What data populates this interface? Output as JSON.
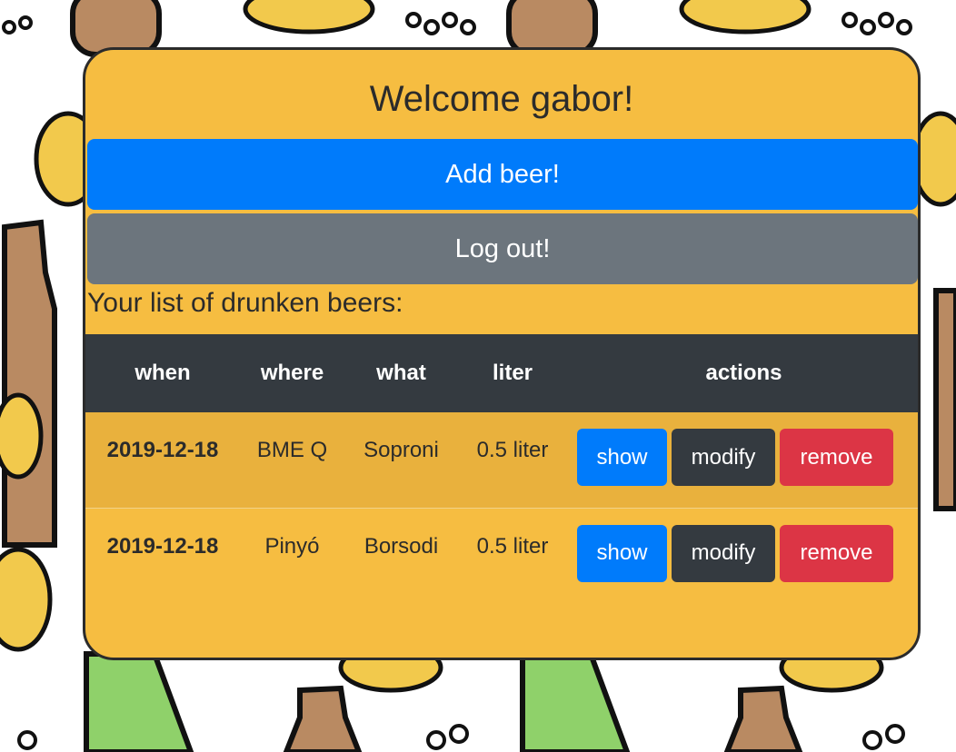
{
  "header": {
    "welcome": "Welcome gabor!"
  },
  "buttons": {
    "add_beer": "Add beer!",
    "log_out": "Log out!"
  },
  "list": {
    "title": "Your list of drunken beers:",
    "columns": [
      "when",
      "where",
      "what",
      "liter",
      "actions"
    ],
    "rows": [
      {
        "when": "2019-12-18",
        "where": "BME Q",
        "what": "Soproni",
        "liter": "0.5 liter",
        "show": "show",
        "modify": "modify",
        "remove": "remove"
      },
      {
        "when": "2019-12-18",
        "where": "Pinyó",
        "what": "Borsodi",
        "liter": "0.5 liter",
        "show": "show",
        "modify": "modify",
        "remove": "remove"
      }
    ]
  },
  "colors": {
    "panel": "#f6bd41",
    "primary": "#007bfb",
    "secondary": "#6c757d",
    "dark": "#343a40",
    "danger": "#dc3545"
  }
}
